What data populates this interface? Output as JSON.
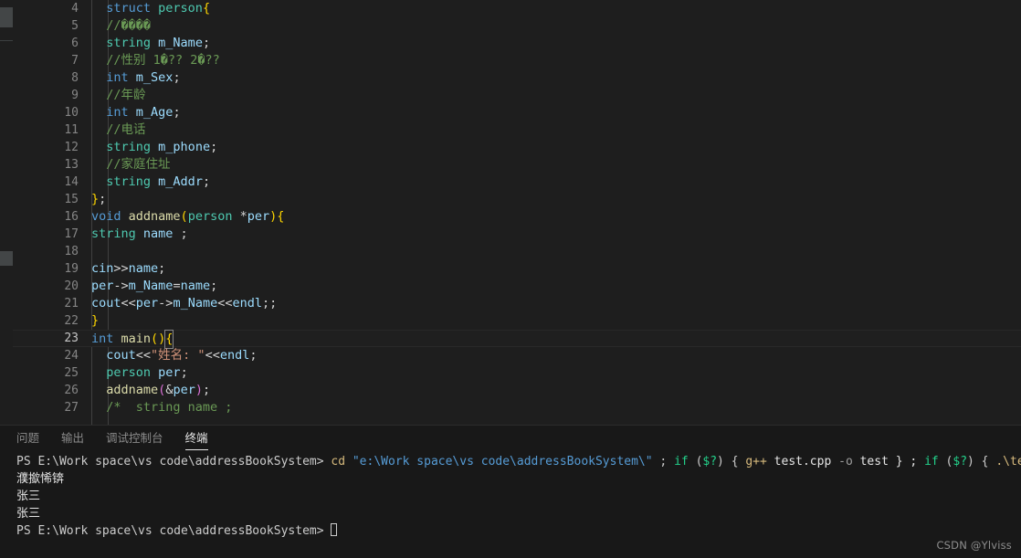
{
  "editor": {
    "first_line_number": 4,
    "active_line": 23,
    "language": "cpp",
    "lines": [
      {
        "n": 4,
        "tokens": [
          {
            "t": "  ",
            "c": "pl"
          },
          {
            "t": "struct ",
            "c": "kw"
          },
          {
            "t": "person",
            "c": "typ"
          },
          {
            "t": "{",
            "c": "br1"
          }
        ]
      },
      {
        "n": 5,
        "tokens": [
          {
            "t": "  ",
            "c": "pl"
          },
          {
            "t": "//",
            "c": "cmt"
          },
          {
            "t": "����",
            "c": "cmt"
          }
        ]
      },
      {
        "n": 6,
        "tokens": [
          {
            "t": "  ",
            "c": "pl"
          },
          {
            "t": "string",
            "c": "typ"
          },
          {
            "t": " m_Name",
            "c": "var"
          },
          {
            "t": ";",
            "c": "pl"
          }
        ]
      },
      {
        "n": 7,
        "tokens": [
          {
            "t": "  ",
            "c": "pl"
          },
          {
            "t": "//性别 1�?? 2�??",
            "c": "cmt"
          }
        ]
      },
      {
        "n": 8,
        "tokens": [
          {
            "t": "  ",
            "c": "pl"
          },
          {
            "t": "int",
            "c": "kw"
          },
          {
            "t": " m_Sex",
            "c": "var"
          },
          {
            "t": ";",
            "c": "pl"
          }
        ]
      },
      {
        "n": 9,
        "tokens": [
          {
            "t": "  ",
            "c": "pl"
          },
          {
            "t": "//年龄",
            "c": "cmt"
          }
        ]
      },
      {
        "n": 10,
        "tokens": [
          {
            "t": "  ",
            "c": "pl"
          },
          {
            "t": "int",
            "c": "kw"
          },
          {
            "t": " m_Age",
            "c": "var"
          },
          {
            "t": ";",
            "c": "pl"
          }
        ]
      },
      {
        "n": 11,
        "tokens": [
          {
            "t": "  ",
            "c": "pl"
          },
          {
            "t": "//电话",
            "c": "cmt"
          }
        ]
      },
      {
        "n": 12,
        "tokens": [
          {
            "t": "  ",
            "c": "pl"
          },
          {
            "t": "string",
            "c": "typ"
          },
          {
            "t": " m_phone",
            "c": "var"
          },
          {
            "t": ";",
            "c": "pl"
          }
        ]
      },
      {
        "n": 13,
        "tokens": [
          {
            "t": "  ",
            "c": "pl"
          },
          {
            "t": "//家庭住址",
            "c": "cmt"
          }
        ]
      },
      {
        "n": 14,
        "tokens": [
          {
            "t": "  ",
            "c": "pl"
          },
          {
            "t": "string",
            "c": "typ"
          },
          {
            "t": " m_Addr",
            "c": "var"
          },
          {
            "t": ";",
            "c": "pl"
          }
        ]
      },
      {
        "n": 15,
        "tokens": [
          {
            "t": "}",
            "c": "br1"
          },
          {
            "t": ";",
            "c": "pl"
          }
        ]
      },
      {
        "n": 16,
        "tokens": [
          {
            "t": "void ",
            "c": "kw"
          },
          {
            "t": "addname",
            "c": "fn"
          },
          {
            "t": "(",
            "c": "br1"
          },
          {
            "t": "person",
            "c": "typ"
          },
          {
            "t": " *",
            "c": "pl"
          },
          {
            "t": "per",
            "c": "var"
          },
          {
            "t": ")",
            "c": "br1"
          },
          {
            "t": "{",
            "c": "br1"
          }
        ]
      },
      {
        "n": 17,
        "tokens": [
          {
            "t": "string",
            "c": "typ"
          },
          {
            "t": " name",
            "c": "var"
          },
          {
            "t": " ;",
            "c": "pl"
          }
        ]
      },
      {
        "n": 18,
        "tokens": []
      },
      {
        "n": 19,
        "tokens": [
          {
            "t": "cin",
            "c": "var"
          },
          {
            "t": ">>",
            "c": "pl"
          },
          {
            "t": "name",
            "c": "var"
          },
          {
            "t": ";",
            "c": "pl"
          }
        ]
      },
      {
        "n": 20,
        "tokens": [
          {
            "t": "per",
            "c": "var"
          },
          {
            "t": "->",
            "c": "pl"
          },
          {
            "t": "m_Name",
            "c": "var"
          },
          {
            "t": "=",
            "c": "pl"
          },
          {
            "t": "name",
            "c": "var"
          },
          {
            "t": ";",
            "c": "pl"
          }
        ]
      },
      {
        "n": 21,
        "tokens": [
          {
            "t": "cout",
            "c": "var"
          },
          {
            "t": "<<",
            "c": "pl"
          },
          {
            "t": "per",
            "c": "var"
          },
          {
            "t": "->",
            "c": "pl"
          },
          {
            "t": "m_Name",
            "c": "var"
          },
          {
            "t": "<<",
            "c": "pl"
          },
          {
            "t": "endl",
            "c": "var"
          },
          {
            "t": ";;",
            "c": "pl"
          }
        ]
      },
      {
        "n": 22,
        "tokens": [
          {
            "t": "}",
            "c": "br1"
          }
        ]
      },
      {
        "n": 23,
        "tokens": [
          {
            "t": "int ",
            "c": "kw"
          },
          {
            "t": "main",
            "c": "fn"
          },
          {
            "t": "()",
            "c": "br1"
          },
          {
            "t": "{",
            "c": "br1",
            "cursor": true
          }
        ]
      },
      {
        "n": 24,
        "tokens": [
          {
            "t": "  ",
            "c": "pl"
          },
          {
            "t": "cout",
            "c": "var"
          },
          {
            "t": "<<",
            "c": "pl"
          },
          {
            "t": "\"姓名: \"",
            "c": "str"
          },
          {
            "t": "<<",
            "c": "pl"
          },
          {
            "t": "endl",
            "c": "var"
          },
          {
            "t": ";",
            "c": "pl"
          }
        ]
      },
      {
        "n": 25,
        "tokens": [
          {
            "t": "  ",
            "c": "pl"
          },
          {
            "t": "person",
            "c": "typ"
          },
          {
            "t": " per",
            "c": "var"
          },
          {
            "t": ";",
            "c": "pl"
          }
        ]
      },
      {
        "n": 26,
        "tokens": [
          {
            "t": "  ",
            "c": "pl"
          },
          {
            "t": "addname",
            "c": "fn"
          },
          {
            "t": "(",
            "c": "br2"
          },
          {
            "t": "&",
            "c": "pl"
          },
          {
            "t": "per",
            "c": "var"
          },
          {
            "t": ")",
            "c": "br2"
          },
          {
            "t": ";",
            "c": "pl"
          }
        ]
      },
      {
        "n": 27,
        "tokens": [
          {
            "t": "  ",
            "c": "pl"
          },
          {
            "t": "/*  string name ;",
            "c": "cmt"
          }
        ]
      }
    ]
  },
  "panel": {
    "tabs": [
      {
        "label": "问题",
        "active": false
      },
      {
        "label": "输出",
        "active": false
      },
      {
        "label": "调试控制台",
        "active": false
      },
      {
        "label": "终端",
        "active": true
      }
    ],
    "terminal": {
      "lines": [
        {
          "name": "terminal-command-line",
          "parts": [
            {
              "t": "PS E:\\Work space\\vs code\\addressBookSystem> ",
              "c": "t-ps"
            },
            {
              "t": "cd ",
              "c": "t-cmd"
            },
            {
              "t": "\"e:\\Work space\\vs code\\addressBookSystem\\\"",
              "c": "t-blue"
            },
            {
              "t": " ; ",
              "c": "t-ps"
            },
            {
              "t": "if ",
              "c": "t-green"
            },
            {
              "t": "(",
              "c": "t-ps"
            },
            {
              "t": "$?",
              "c": "t-green"
            },
            {
              "t": ") { ",
              "c": "t-ps"
            },
            {
              "t": "g++",
              "c": "t-cmd"
            },
            {
              "t": " test.cpp ",
              "c": "t-white"
            },
            {
              "t": "-o",
              "c": "t-dim"
            },
            {
              "t": " test } ; ",
              "c": "t-white"
            },
            {
              "t": "if ",
              "c": "t-green"
            },
            {
              "t": "(",
              "c": "t-ps"
            },
            {
              "t": "$?",
              "c": "t-green"
            },
            {
              "t": ") { ",
              "c": "t-ps"
            },
            {
              "t": ".\\test",
              "c": "t-cmd"
            },
            {
              "t": " }",
              "c": "t-ps"
            }
          ]
        },
        {
          "name": "terminal-output-line",
          "parts": [
            {
              "t": "濮撳悕锛",
              "c": "t-white cjk"
            }
          ]
        },
        {
          "name": "terminal-output-line",
          "parts": [
            {
              "t": "张三",
              "c": "t-white cjk"
            }
          ]
        },
        {
          "name": "terminal-output-line",
          "parts": [
            {
              "t": "张三",
              "c": "t-white cjk"
            }
          ]
        },
        {
          "name": "terminal-prompt-line",
          "parts": [
            {
              "t": "PS E:\\Work space\\vs code\\addressBookSystem> ",
              "c": "t-ps"
            }
          ],
          "cursor": true
        }
      ]
    }
  },
  "watermark": {
    "text": "CSDN @Ylviss"
  },
  "colors": {
    "background": "#1e1e1e",
    "panel_background": "#181818",
    "keyword": "#569cd6",
    "type": "#4ec9b0",
    "function": "#dcdcaa",
    "variable": "#9cdcfe",
    "comment": "#6a9955",
    "string": "#ce9178",
    "bracket1": "#ffd700",
    "bracket2": "#da70d6",
    "line_number": "#858585",
    "active_line_number": "#c6c6c6",
    "terminal_text": "#cccccc"
  }
}
